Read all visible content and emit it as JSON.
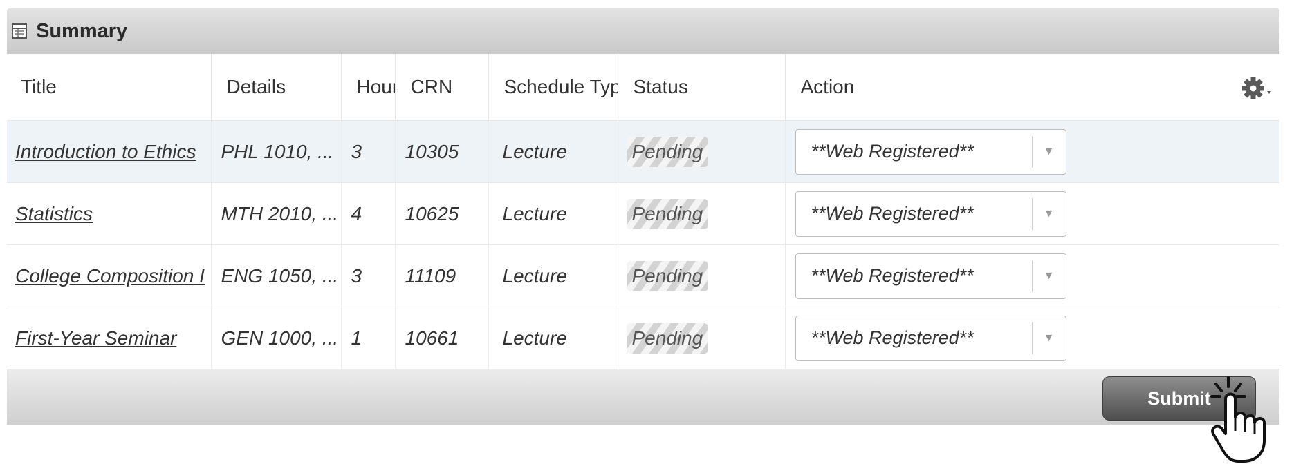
{
  "panel": {
    "title": "Summary",
    "header_icon": "table-icon"
  },
  "columns": [
    "Title",
    "Details",
    "Hours",
    "CRN",
    "Schedule Type",
    "Status",
    "Action"
  ],
  "settings_icon": "gear-icon",
  "rows": [
    {
      "title": "Introduction to Ethics",
      "details": "PHL 1010, ...",
      "hours": "3",
      "crn": "10305",
      "schedule_type": "Lecture",
      "status": "Pending",
      "action": "**Web Registered**"
    },
    {
      "title": "Statistics",
      "details": "MTH 2010, ...",
      "hours": "4",
      "crn": "10625",
      "schedule_type": "Lecture",
      "status": "Pending",
      "action": "**Web Registered**"
    },
    {
      "title": "College Composition I",
      "details": "ENG 1050, ...",
      "hours": "3",
      "crn": "11109",
      "schedule_type": "Lecture",
      "status": "Pending",
      "action": "**Web Registered**"
    },
    {
      "title": "First-Year Seminar",
      "details": "GEN 1000, ...",
      "hours": "1",
      "crn": "10661",
      "schedule_type": "Lecture",
      "status": "Pending",
      "action": "**Web Registered**"
    }
  ],
  "footer": {
    "submit_label": "Submit",
    "cursor_icon": "hand-pointer-click-icon"
  },
  "colors": {
    "header_bg": "#d4d4d4",
    "highlight_row": "#eef3f8",
    "submit_bg": "#5e5e5e"
  }
}
